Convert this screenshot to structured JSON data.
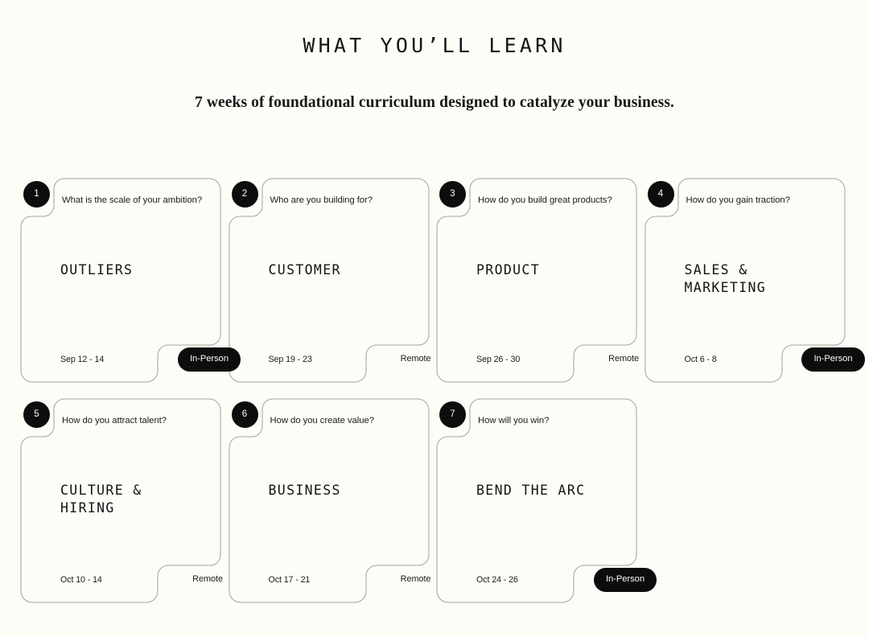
{
  "header": {
    "title": "WHAT YOU’LL LEARN",
    "subtitle": "7 weeks of foundational curriculum designed to catalyze your business."
  },
  "theme": {
    "background": "#fdfcf6",
    "text": "#141414",
    "badge_bg": "#0d0d0d",
    "badge_text": "#fdfcf6",
    "card_border": "#a8a59b"
  },
  "labels": {
    "in_person": "In-Person",
    "remote": "Remote"
  },
  "cards": [
    {
      "number": "1",
      "question": "What is the scale of your ambition?",
      "topic": "OUTLIERS",
      "date": "Sep 12 - 14",
      "format": "In-Person",
      "format_style": "pill"
    },
    {
      "number": "2",
      "question": "Who are you building for?",
      "topic": "CUSTOMER",
      "date": "Sep 19 - 23",
      "format": "Remote",
      "format_style": "plain"
    },
    {
      "number": "3",
      "question": "How do you build great products?",
      "topic": "PRODUCT",
      "date": "Sep 26 - 30",
      "format": "Remote",
      "format_style": "plain"
    },
    {
      "number": "4",
      "question": "How do you gain traction?",
      "topic": "SALES &\nMARKETING",
      "date": "Oct 6 - 8",
      "format": "In-Person",
      "format_style": "pill"
    },
    {
      "number": "5",
      "question": "How do you attract talent?",
      "topic": "CULTURE &\nHIRING",
      "date": "Oct 10 - 14",
      "format": "Remote",
      "format_style": "plain"
    },
    {
      "number": "6",
      "question": "How do you create value?",
      "topic": "BUSINESS",
      "date": "Oct 17 - 21",
      "format": "Remote",
      "format_style": "plain"
    },
    {
      "number": "7",
      "question": "How will you win?",
      "topic": "BEND THE ARC",
      "date": "Oct 24 - 26",
      "format": "In-Person",
      "format_style": "pill"
    }
  ]
}
